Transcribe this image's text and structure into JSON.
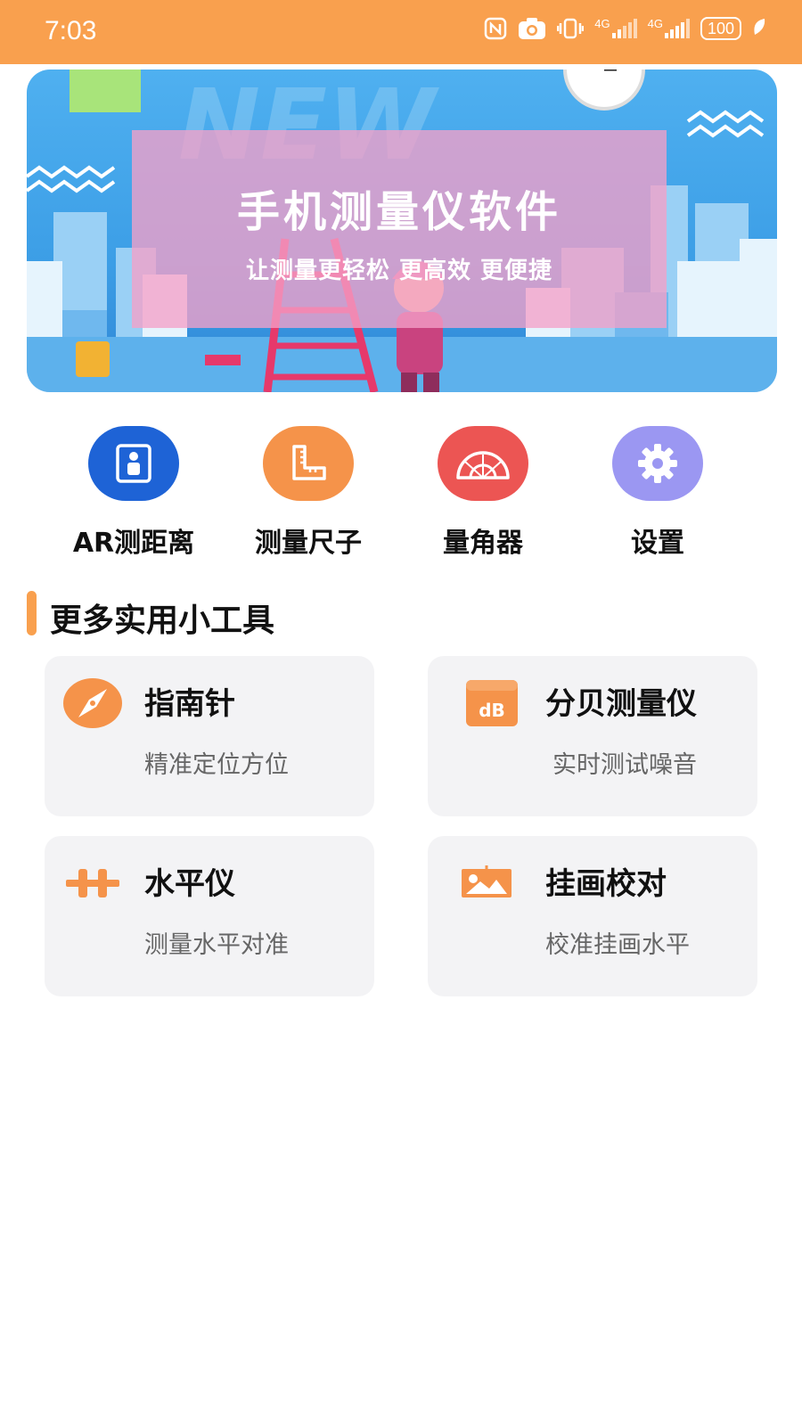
{
  "status_bar": {
    "time": "7:03",
    "net1": "4G",
    "net2": "4G",
    "battery": "100"
  },
  "banner": {
    "title": "手机测量仪软件",
    "subtitle": "让测量更轻松 更高效 更便捷",
    "watermark": "NEW"
  },
  "quick_tools": [
    {
      "label": "AR测距离",
      "icon": "ar-ruler-icon",
      "color": "#1E63D6"
    },
    {
      "label": "测量尺子",
      "icon": "square-ruler-icon",
      "color": "#F5934A"
    },
    {
      "label": "量角器",
      "icon": "protractor-icon",
      "color": "#EC5553"
    },
    {
      "label": "设置",
      "icon": "gear-icon",
      "color": "#9B97F2"
    }
  ],
  "section": {
    "title": "更多实用小工具"
  },
  "tools": [
    {
      "title": "指南针",
      "subtitle": "精准定位方位",
      "icon": "compass-icon"
    },
    {
      "title": "分贝测量仪",
      "subtitle": "实时测试噪音",
      "icon": "decibel-icon",
      "icon_text": "dB"
    },
    {
      "title": "水平仪",
      "subtitle": "测量水平对准",
      "icon": "level-icon"
    },
    {
      "title": "挂画校对",
      "subtitle": "校准挂画水平",
      "icon": "picture-frame-icon"
    }
  ],
  "colors": {
    "accent": "#F9A04E",
    "card_bg": "#F3F3F5"
  }
}
